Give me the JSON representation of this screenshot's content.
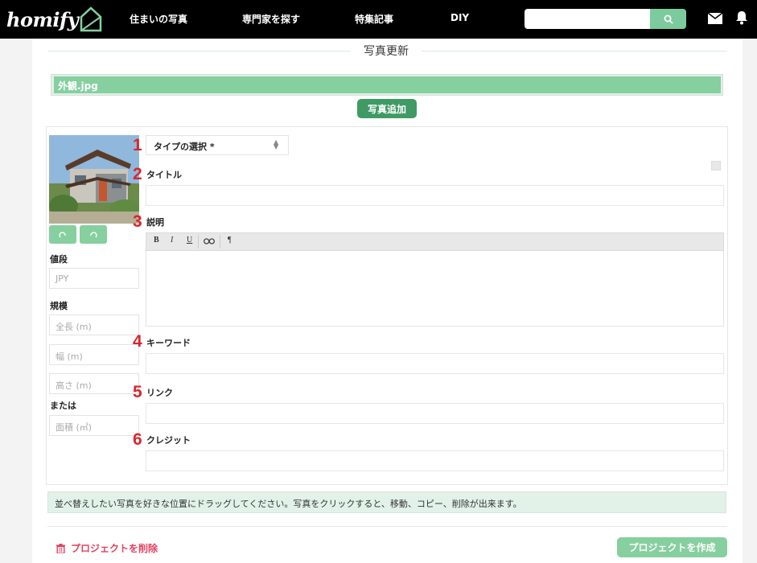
{
  "header": {
    "logo_text": "homify",
    "nav": [
      "住まいの写真",
      "専門家を探す",
      "特集記事",
      "DIY"
    ],
    "search": {
      "value": "",
      "placeholder": ""
    },
    "icons": [
      "search-icon",
      "mail-icon",
      "bell-icon"
    ]
  },
  "page": {
    "title": "写真更新",
    "file_name": "外観.jpg",
    "add_photo_button": "写真追加"
  },
  "side": {
    "price_label": "値段",
    "price_placeholder": "JPY",
    "scale_label": "規模",
    "length_placeholder": "全長 (m)",
    "width_placeholder": "幅 (m)",
    "height_placeholder": "高さ (m)",
    "or_label": "または",
    "area_placeholder": "面積 (㎡)",
    "rotate_left_icon": "rotate-left-icon",
    "rotate_right_icon": "rotate-right-icon"
  },
  "form": {
    "numbers": [
      "1",
      "2",
      "3",
      "4",
      "5",
      "6"
    ],
    "type_select": "タイプの選択 *",
    "title_label": "タイトル",
    "description_label": "説明",
    "toolbar": {
      "bold": "B",
      "italic": "I",
      "underline": "U",
      "link": "link-icon",
      "paragraph": "¶"
    },
    "keyword_label": "キーワード",
    "link_label": "リンク",
    "credit_label": "クレジット"
  },
  "footer": {
    "info_text": "並べ替えしたい写真を好きな位置にドラッグしてください。写真をクリックすると、移動、コピー、削除が出来ます。",
    "delete_label": "プロジェクトを削除",
    "create_button": "プロジェクトを作成"
  },
  "colors": {
    "brand_green": "#86cf9f",
    "dark_green": "#3f9a64",
    "delete_red": "#e4405f",
    "number_red": "#d8262f"
  }
}
